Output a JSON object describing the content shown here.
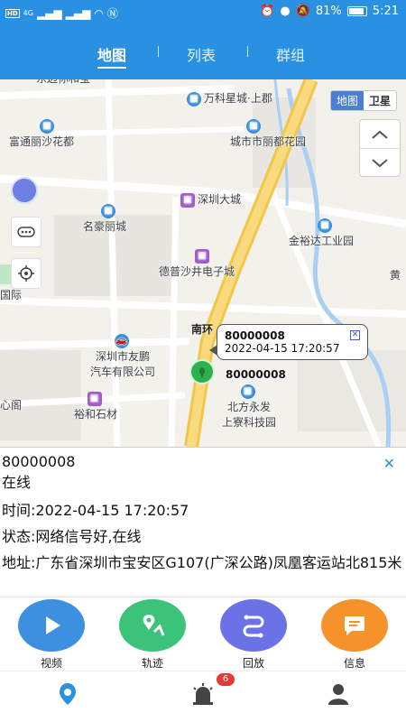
{
  "status_bar": {
    "left": [
      "HD",
      "4G",
      "HD",
      "4G"
    ],
    "battery": "81%",
    "time": "5:21"
  },
  "header": {
    "tabs": [
      {
        "label": "地图",
        "active": true
      },
      {
        "label": "列表",
        "active": false
      },
      {
        "label": "群组",
        "active": false
      }
    ]
  },
  "map": {
    "map_type": {
      "map": "地图",
      "satellite": "卫星",
      "selected": "地图"
    },
    "pois": [
      {
        "text": "万科星城·上郡",
        "icon": "building-icon"
      },
      {
        "text": "富通丽沙花都",
        "icon": "building-icon"
      },
      {
        "text": "城市市丽都花园",
        "icon": "building-icon"
      },
      {
        "text": "深圳大城",
        "icon": "building-icon"
      },
      {
        "text": "名豪丽城",
        "icon": "building-icon"
      },
      {
        "text": "金裕达工业园",
        "icon": "building-icon"
      },
      {
        "text": "德普沙井电子城",
        "icon": "shop-icon"
      },
      {
        "text": "国际",
        "icon": ""
      },
      {
        "text": "深圳市友鹏\n汽车有限公司",
        "icon": "car-icon"
      },
      {
        "text": "裕和石材",
        "icon": "shop-icon"
      },
      {
        "text": "北方永发\n上寮科技园",
        "icon": "building-icon"
      },
      {
        "text": "黄",
        "icon": ""
      },
      {
        "text": "心阁",
        "icon": ""
      }
    ],
    "road_label": "南环",
    "popup": {
      "device_id": "80000008",
      "time": "2022-04-15 17:20:57"
    },
    "marker_label": "80000008"
  },
  "info": {
    "device_id": "80000008",
    "online_status": "在线",
    "time_label": "时间:",
    "time_value": "2022-04-15 17:20:57",
    "state_label": "状态:",
    "state_value": "网络信号好,在线",
    "address_label": "地址:",
    "address_value": "广东省深圳市宝安区G107(广深公路)凤凰客运站北815米"
  },
  "actions": [
    {
      "label": "视频",
      "color": "#3d8fe0",
      "icon": "play-icon"
    },
    {
      "label": "轨迹",
      "color": "#3cc37a",
      "icon": "track-icon"
    },
    {
      "label": "回放",
      "color": "#6a72e6",
      "icon": "playback-icon"
    },
    {
      "label": "信息",
      "color": "#f5922a",
      "icon": "message-icon"
    }
  ],
  "bottom_nav": {
    "alarm_badge": "6"
  },
  "colors": {
    "primary": "#2a90e2",
    "online_marker": "#2db14f",
    "badge": "#e53935"
  }
}
